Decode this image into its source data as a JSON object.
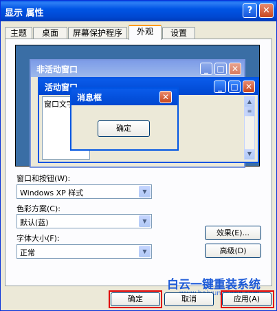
{
  "window": {
    "title": "显示 属性",
    "help_glyph": "?",
    "close_glyph": "✕"
  },
  "tabs": [
    "主题",
    "桌面",
    "屏幕保护程序",
    "外观",
    "设置"
  ],
  "active_tab": "外观",
  "preview": {
    "inactive_title": "非活动窗口",
    "active_title": "活动窗口",
    "window_text": "窗口文字",
    "message_box_title": "消息框",
    "message_box_ok": "确定"
  },
  "fields": {
    "style_label": "窗口和按钮(W):",
    "style_value": "Windows XP 样式",
    "scheme_label": "色彩方案(C):",
    "scheme_value": "默认(蓝)",
    "font_label": "字体大小(F):",
    "font_value": "正常"
  },
  "buttons": {
    "effects": "效果(E)...",
    "advanced": "高级(D)",
    "ok": "确定",
    "cancel": "取消",
    "apply": "应用(A)"
  },
  "watermark": {
    "text": "白云一键重装系统",
    "url": "www.baiyunxitong.com"
  },
  "colors": {
    "title_blue": "#0054E3",
    "face": "#ECE9D8",
    "highlight_red": "#E00000"
  }
}
